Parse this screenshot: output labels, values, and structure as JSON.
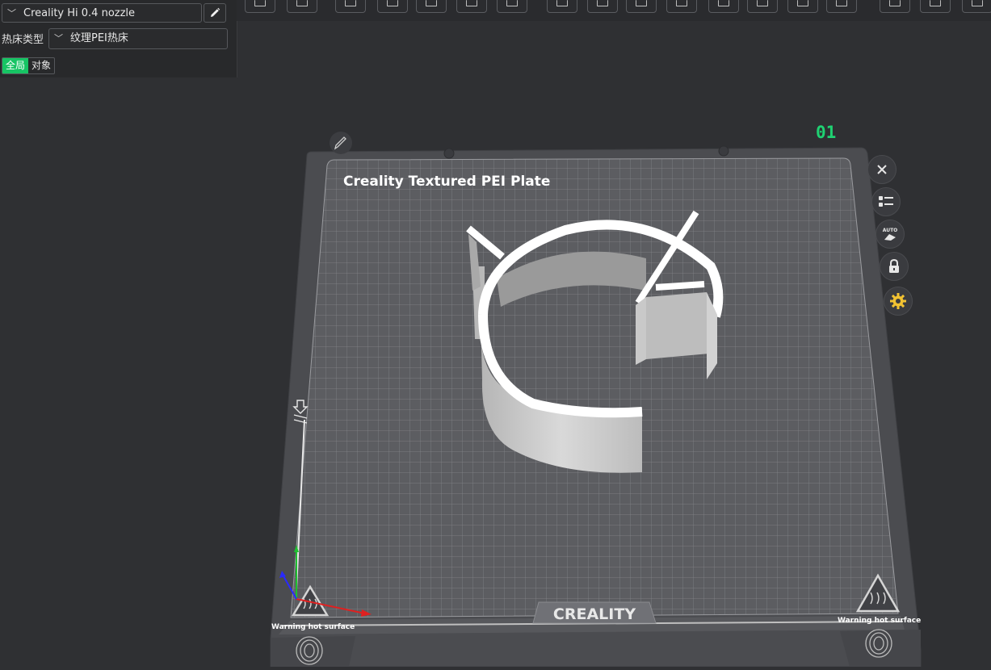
{
  "printer": {
    "name": "Creality Hi 0.4 nozzle"
  },
  "bed": {
    "label": "热床类型",
    "value": "纹理PEI热床"
  },
  "tabs": [
    {
      "label": "全局",
      "active": true
    },
    {
      "label": "对象",
      "active": false
    }
  ],
  "plate": {
    "number": "01",
    "title": "Creality Textured PEI Plate",
    "brand": "CREALITY",
    "warning_left": "Warning hot surface",
    "warning_right": "Warning hot surface"
  },
  "colors": {
    "accent": "#17c464",
    "plate_number": "#1fd172",
    "settings_icon": "#f1c232"
  }
}
